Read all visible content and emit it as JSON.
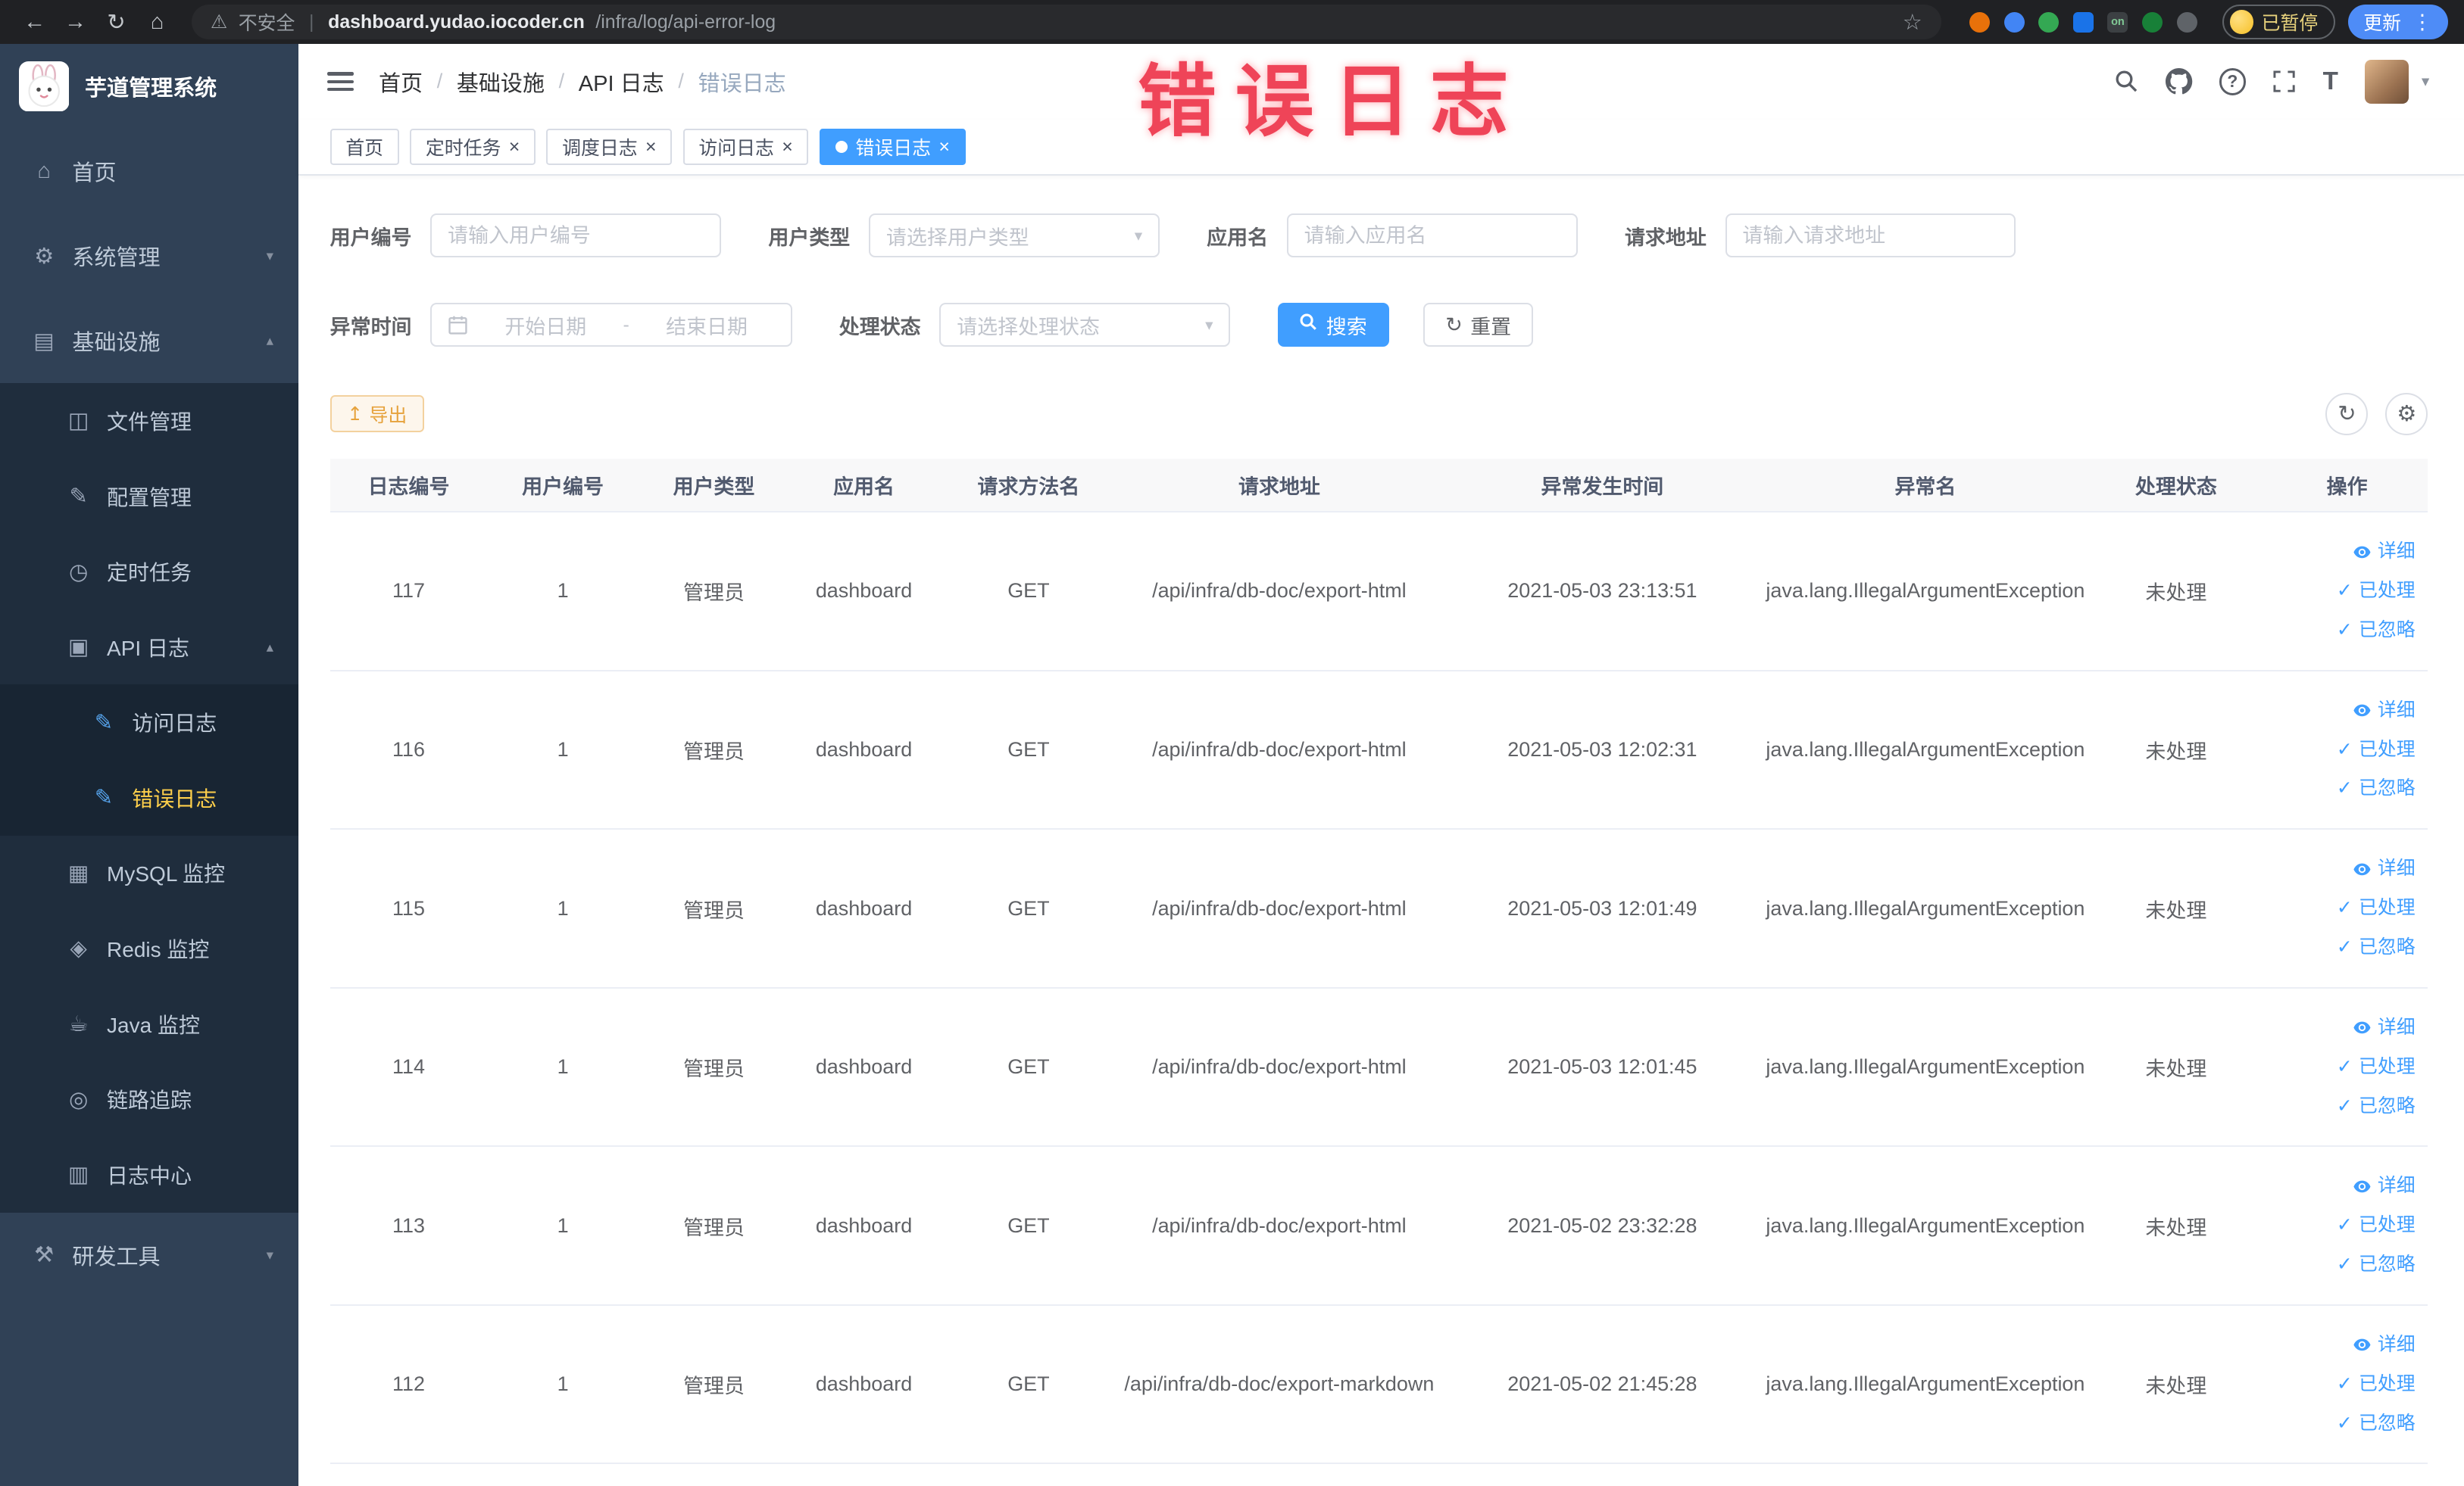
{
  "colors": {
    "accent": "#409eff",
    "menu_active": "#ffd04b",
    "warning": "#e6a23c",
    "annotation": "#ef4458"
  },
  "browser": {
    "security_label": "不安全",
    "url_domain": "dashboard.yudao.iocoder.cn",
    "url_path": "/infra/log/api-error-log",
    "extension_badge": "on",
    "paused_label": "已暂停",
    "update_label": "更新"
  },
  "annotation": {
    "text": "错误日志"
  },
  "sidebar": {
    "logo_title": "芋道管理系统",
    "menu": [
      {
        "key": "home",
        "label": "首页",
        "icon": "home-icon",
        "level": 1
      },
      {
        "key": "system",
        "label": "系统管理",
        "icon": "gear-icon",
        "level": 1,
        "arrow": "down"
      },
      {
        "key": "infra",
        "label": "基础设施",
        "icon": "infra-icon",
        "level": 1,
        "arrow": "up"
      },
      {
        "key": "file",
        "label": "文件管理",
        "icon": "folder-icon",
        "level": 2
      },
      {
        "key": "config",
        "label": "配置管理",
        "icon": "edit-icon",
        "level": 2
      },
      {
        "key": "job",
        "label": "定时任务",
        "icon": "timer-icon",
        "level": 2
      },
      {
        "key": "api-log",
        "label": "API 日志",
        "icon": "log-icon",
        "level": 2,
        "arrow": "up"
      },
      {
        "key": "access-log",
        "label": "访问日志",
        "icon": "edit-square-icon",
        "level": 3
      },
      {
        "key": "error-log",
        "label": "错误日志",
        "icon": "edit-square-icon",
        "level": 3,
        "active": true
      },
      {
        "key": "mysql",
        "label": "MySQL 监控",
        "icon": "monitor-icon",
        "level": 2
      },
      {
        "key": "redis",
        "label": "Redis 监控",
        "icon": "redis-icon",
        "level": 2
      },
      {
        "key": "java",
        "label": "Java 监控",
        "icon": "java-icon",
        "level": 2
      },
      {
        "key": "trace",
        "label": "链路追踪",
        "icon": "trace-icon",
        "level": 2
      },
      {
        "key": "log-center",
        "label": "日志中心",
        "icon": "log-center-icon",
        "level": 2
      },
      {
        "key": "devtools",
        "label": "研发工具",
        "icon": "tools-icon",
        "level": 1,
        "arrow": "down"
      }
    ]
  },
  "header": {
    "breadcrumb": [
      "首页",
      "基础设施",
      "API 日志",
      "错误日志"
    ]
  },
  "tabs": [
    {
      "key": "home",
      "label": "首页",
      "closable": false,
      "active": false
    },
    {
      "key": "job",
      "label": "定时任务",
      "closable": true,
      "active": false
    },
    {
      "key": "job-log",
      "label": "调度日志",
      "closable": true,
      "active": false
    },
    {
      "key": "access-log",
      "label": "访问日志",
      "closable": true,
      "active": false
    },
    {
      "key": "error-log",
      "label": "错误日志",
      "closable": true,
      "active": true
    }
  ],
  "filters": {
    "rows": [
      [
        {
          "name": "user-id",
          "label": "用户编号",
          "type": "input",
          "placeholder": "请输入用户编号"
        },
        {
          "name": "user-type",
          "label": "用户类型",
          "type": "select",
          "placeholder": "请选择用户类型"
        },
        {
          "name": "app-name",
          "label": "应用名",
          "type": "input",
          "placeholder": "请输入应用名"
        },
        {
          "name": "request-url",
          "label": "请求地址",
          "type": "input",
          "placeholder": "请输入请求地址"
        }
      ],
      [
        {
          "name": "exception-time",
          "label": "异常时间",
          "type": "daterange",
          "start_placeholder": "开始日期",
          "end_placeholder": "结束日期",
          "separator": "-"
        },
        {
          "name": "process-status",
          "label": "处理状态",
          "type": "select",
          "placeholder": "请选择处理状态"
        }
      ]
    ],
    "search_label": "搜索",
    "reset_label": "重置"
  },
  "toolbar": {
    "export_label": "导出"
  },
  "table": {
    "columns": [
      "日志编号",
      "用户编号",
      "用户类型",
      "应用名",
      "请求方法名",
      "请求地址",
      "异常发生时间",
      "异常名",
      "处理状态",
      "操作"
    ],
    "actions": [
      "详细",
      "已处理",
      "已忽略"
    ],
    "rows": [
      {
        "id": "117",
        "user_id": "1",
        "user_type": "管理员",
        "app": "dashboard",
        "method": "GET",
        "url": "/api/infra/db-doc/export-html",
        "time": "2021-05-03 23:13:51",
        "exception": "java.lang.IllegalArgumentException",
        "status": "未处理"
      },
      {
        "id": "116",
        "user_id": "1",
        "user_type": "管理员",
        "app": "dashboard",
        "method": "GET",
        "url": "/api/infra/db-doc/export-html",
        "time": "2021-05-03 12:02:31",
        "exception": "java.lang.IllegalArgumentException",
        "status": "未处理"
      },
      {
        "id": "115",
        "user_id": "1",
        "user_type": "管理员",
        "app": "dashboard",
        "method": "GET",
        "url": "/api/infra/db-doc/export-html",
        "time": "2021-05-03 12:01:49",
        "exception": "java.lang.IllegalArgumentException",
        "status": "未处理"
      },
      {
        "id": "114",
        "user_id": "1",
        "user_type": "管理员",
        "app": "dashboard",
        "method": "GET",
        "url": "/api/infra/db-doc/export-html",
        "time": "2021-05-03 12:01:45",
        "exception": "java.lang.IllegalArgumentException",
        "status": "未处理"
      },
      {
        "id": "113",
        "user_id": "1",
        "user_type": "管理员",
        "app": "dashboard",
        "method": "GET",
        "url": "/api/infra/db-doc/export-html",
        "time": "2021-05-02 23:32:28",
        "exception": "java.lang.IllegalArgumentException",
        "status": "未处理"
      },
      {
        "id": "112",
        "user_id": "1",
        "user_type": "管理员",
        "app": "dashboard",
        "method": "GET",
        "url": "/api/infra/db-doc/export-markdown",
        "time": "2021-05-02 21:45:28",
        "exception": "java.lang.IllegalArgumentException",
        "status": "未处理"
      }
    ]
  }
}
